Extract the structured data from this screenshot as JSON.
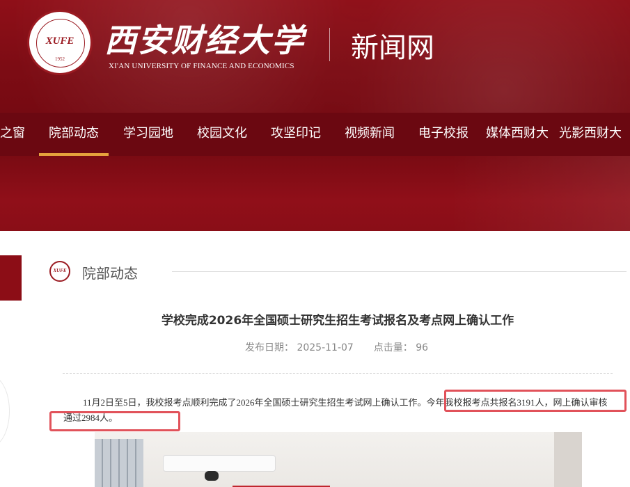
{
  "header": {
    "seal": {
      "abbr": "XUFE",
      "year": "1952"
    },
    "school_name_cn": "西安财经大学",
    "school_name_en": "XI'AN UNIVERSITY OF FINANCE AND ECONOMICS",
    "site_name": "新闻网"
  },
  "nav": {
    "items": [
      {
        "label": "之窗",
        "active": false
      },
      {
        "label": "院部动态",
        "active": true
      },
      {
        "label": "学习园地",
        "active": false
      },
      {
        "label": "校园文化",
        "active": false
      },
      {
        "label": "攻坚印记",
        "active": false
      },
      {
        "label": "视频新闻",
        "active": false
      },
      {
        "label": "电子校报",
        "active": false
      },
      {
        "label": "媒体西财大",
        "active": false
      },
      {
        "label": "光影西财大",
        "active": false
      }
    ]
  },
  "section": {
    "icon_text": "XUFE",
    "title": "院部动态"
  },
  "article": {
    "title": "学校完成2026年全国硕士研究生招生考试报名及考点网上确认工作",
    "date_label": "发布日期：",
    "date": "2025-11-07",
    "clicks_label": "点击量：",
    "clicks": "96",
    "paragraph": "11月2日至5日，我校报考点顺利完成了2026年全国硕士研究生招生考试网上确认工作。今年我校报考点共报名3191人，网上确认审核通过2984人。"
  },
  "colors": {
    "brand_red": "#8f0f18",
    "nav_red": "#6b0811",
    "active_underline": "#e6a23c",
    "highlight_box": "#e1525a"
  }
}
